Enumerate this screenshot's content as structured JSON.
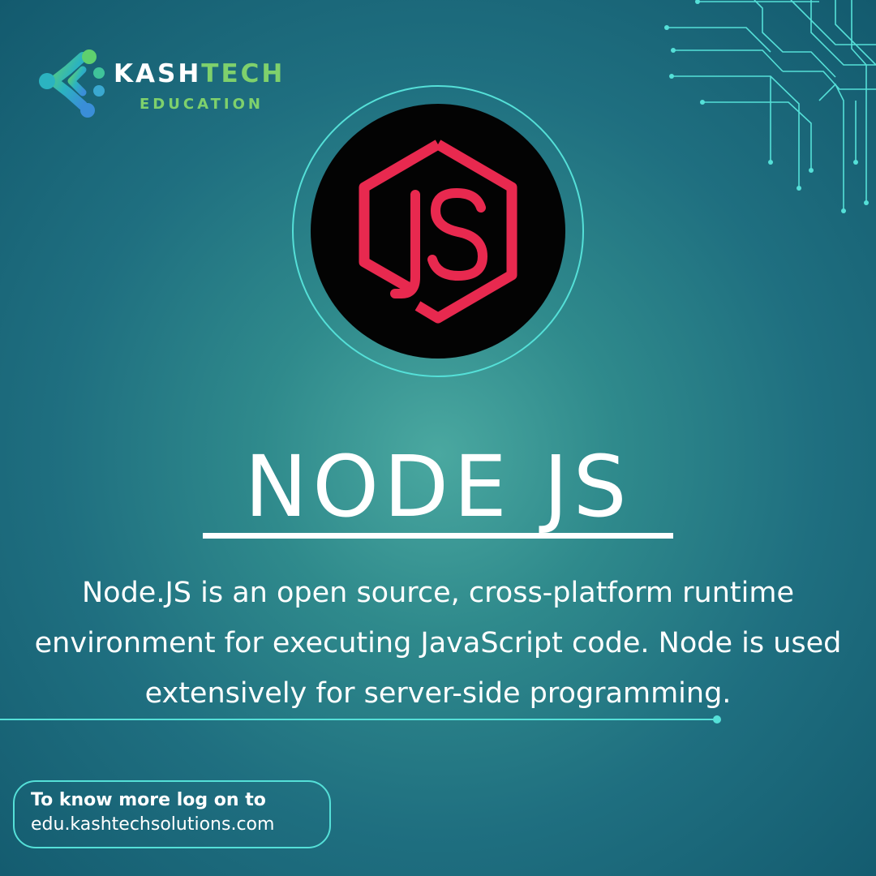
{
  "brand": {
    "name_part1": "KASH",
    "name_part2": "TECH",
    "subtitle": "EDUCATION"
  },
  "hero": {
    "logo_icon": "node-js-hexagon-icon",
    "logo_text": "JS"
  },
  "title": "NODE JS",
  "description": "Node.JS is an open source, cross-platform runtime environment for executing JavaScript code. Node is used extensively for server-side programming.",
  "cta": {
    "label": "To know more log on to",
    "url": "edu.kashtechsolutions.com"
  },
  "colors": {
    "accent": "#55e0d8",
    "brand_green": "#7fd16c",
    "node_red": "#e8294f",
    "background": "#2f8a8c"
  }
}
